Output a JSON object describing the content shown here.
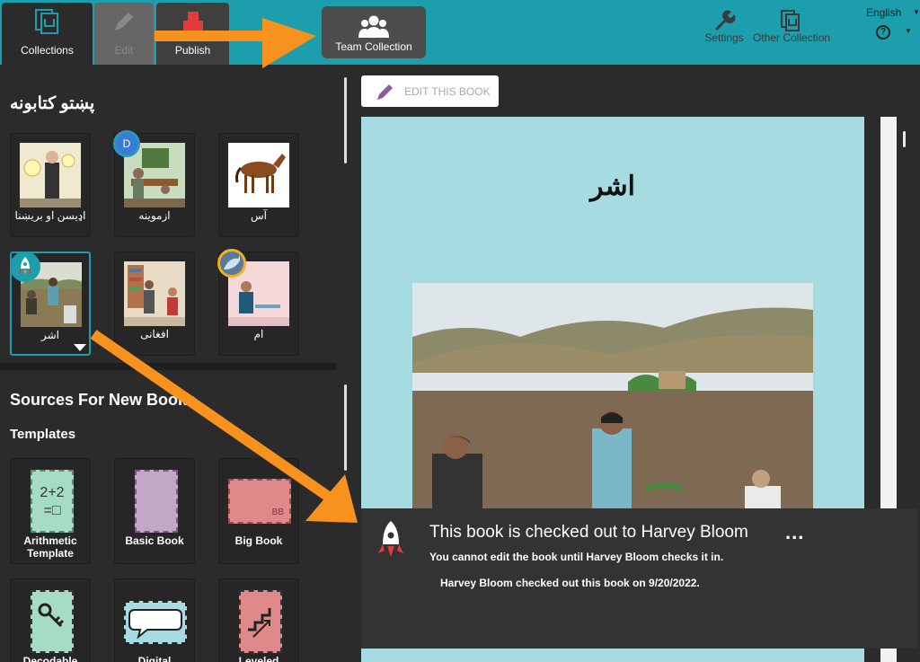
{
  "topbar": {
    "tabs": [
      {
        "label": "Collections"
      },
      {
        "label": "Edit"
      },
      {
        "label": "Publish"
      }
    ],
    "team_collection_label": "Team Collection",
    "settings_label": "Settings",
    "other_collection_label": "Other Collection",
    "language": "English",
    "help_symbol": "?"
  },
  "collection": {
    "title": "پښتو کتابونه",
    "books": [
      {
        "name": "اډیسن او بریښنا"
      },
      {
        "name": "ازموینه",
        "badge": "D"
      },
      {
        "name": "آس"
      },
      {
        "name": "اشر"
      },
      {
        "name": "افغانی"
      },
      {
        "name": "ام"
      }
    ]
  },
  "sources": {
    "title": "Sources For New Books",
    "templates_heading": "Templates",
    "templates": [
      {
        "name": "Arithmetic Template",
        "thumb_text": "2+2 =□"
      },
      {
        "name": "Basic Book"
      },
      {
        "name": "Big Book",
        "thumb_text": "BB"
      },
      {
        "name": "Decodable"
      },
      {
        "name": "Digital"
      },
      {
        "name": "Leveled"
      }
    ]
  },
  "preview": {
    "edit_button": "EDIT THIS BOOK",
    "page_title": "اشر"
  },
  "notice": {
    "title": "This book is checked out to Harvey Bloom",
    "message": "You cannot edit the book until Harvey Bloom checks it in.",
    "detail": "Harvey Bloom checked out this book on 9/20/2022.",
    "more": "..."
  },
  "colors": {
    "topbar": "#1c9eac",
    "panel": "#2b2b2b",
    "arrow": "#f7921e",
    "page": "#a7dbe2"
  }
}
